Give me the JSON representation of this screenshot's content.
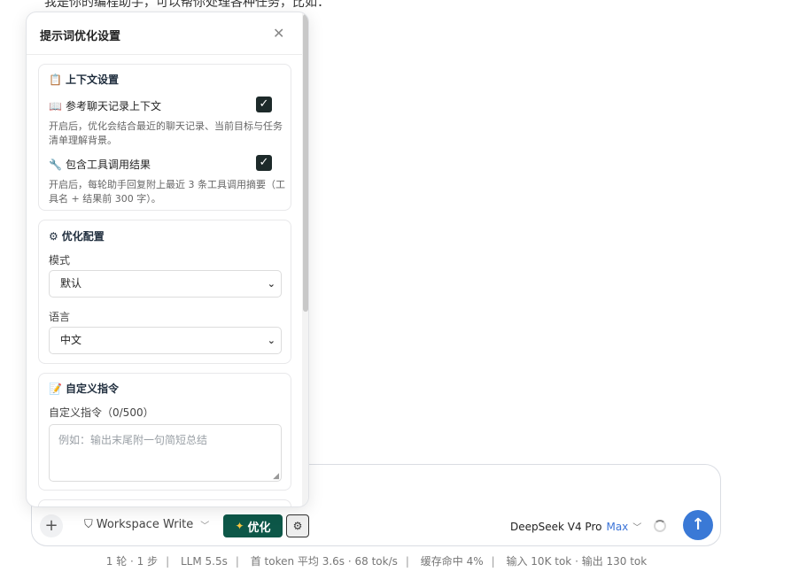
{
  "background": {
    "partial_text": "我是你的编程助手，可以帮你处理各种任务，比如："
  },
  "panel": {
    "title": "提示词优化设置",
    "context": {
      "title": "上下文设置",
      "chat_history_label": "参考聊天记录上下文",
      "chat_history_checked": true,
      "chat_history_desc": "开启后，优化会结合最近的聊天记录、当前目标与任务清单理解背景。",
      "tool_results_label": "包含工具调用结果",
      "tool_results_checked": true,
      "tool_results_desc": "开启后，每轮助手回复附上最近 3 条工具调用摘要（工具名 + 结果前 300 字）。"
    },
    "optimize": {
      "title": "优化配置",
      "mode_label": "模式",
      "mode_value": "默认",
      "language_label": "语言",
      "language_value": "中文"
    },
    "custom": {
      "title": "自定义指令",
      "field_label": "自定义指令（0/500）",
      "placeholder": "例如：输出末尾附一句简短总结"
    }
  },
  "composer": {
    "workspace_label": "Workspace Write",
    "optimize_label": "优化",
    "model_name": "DeepSeek V4 Pro",
    "model_tier": "Max"
  },
  "status": {
    "items": [
      "1 轮 · 1 步",
      "LLM 5.5s",
      "首 token 平均 3.6s · 68 tok/s",
      "缓存命中 4%",
      "输入 10K tok · 输出 130 tok"
    ]
  },
  "icons": {
    "close": "close-icon",
    "clipboard": "clipboard-icon",
    "book": "book-icon",
    "wrench": "wrench-icon",
    "gear": "gear-icon",
    "memo": "memo-icon",
    "plus": "plus-icon",
    "send": "send-arrow-icon",
    "spinner": "loading-spinner-icon"
  },
  "colors": {
    "accent_green": "#0d5748",
    "send_blue": "#3a79d6",
    "max_blue": "#3b74d8"
  }
}
